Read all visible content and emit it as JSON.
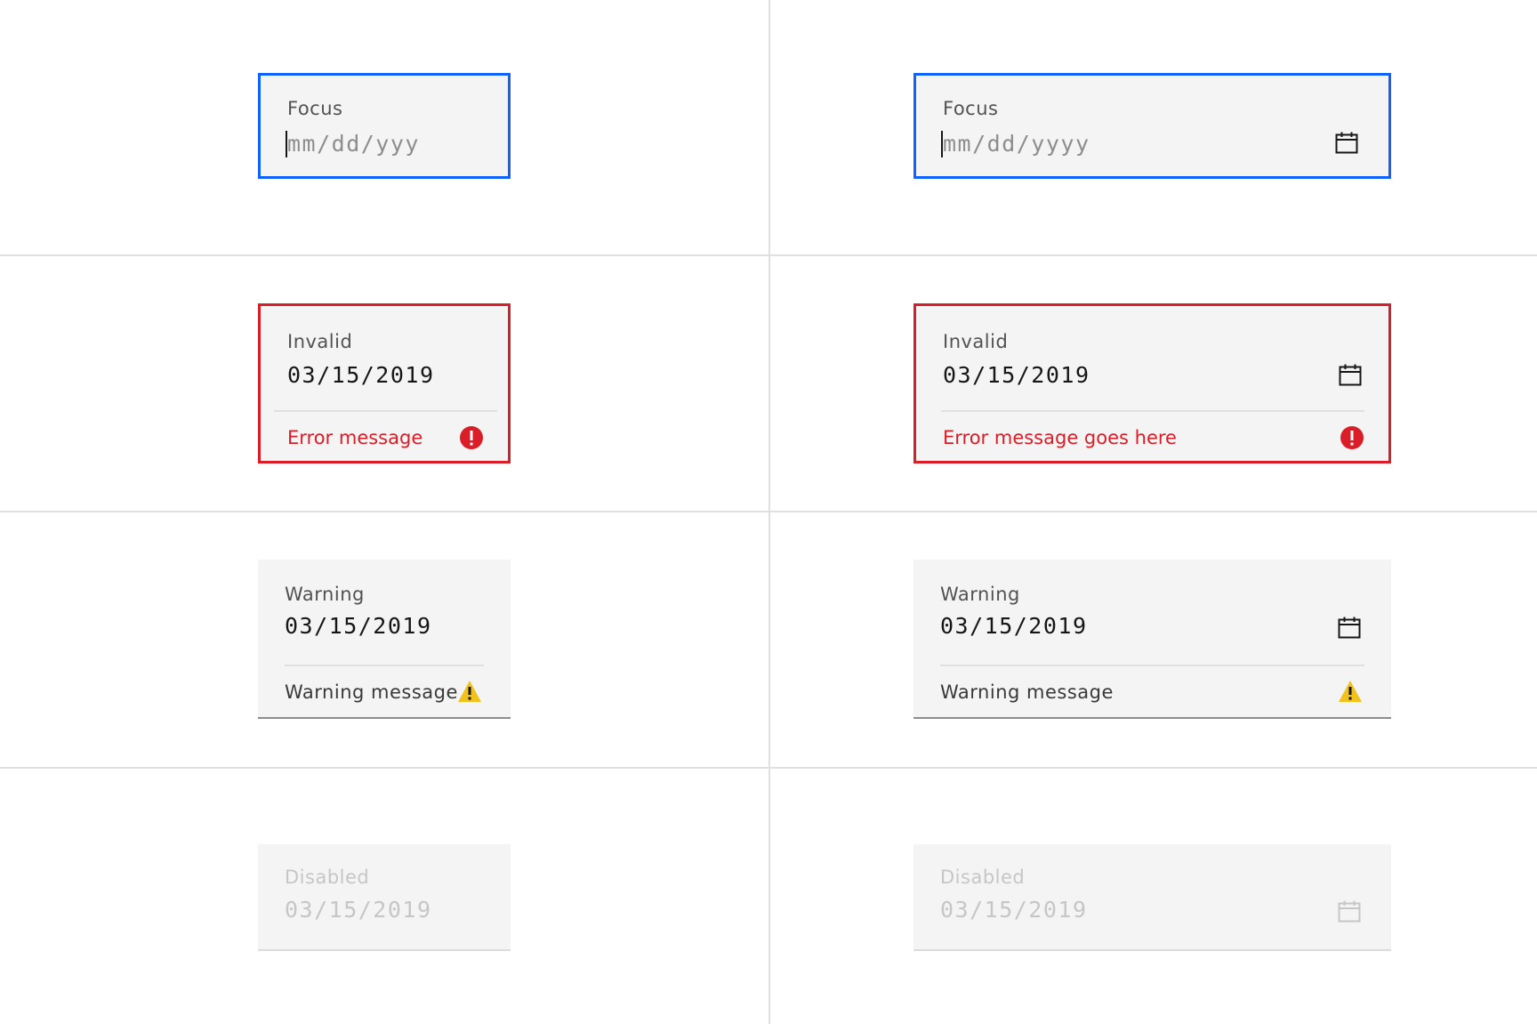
{
  "colors": {
    "focus": "#0f62fe",
    "error": "#da1e28",
    "warning": "#f1c21b",
    "field_background": "#f4f4f4",
    "disabled_text": "#c6c6c6"
  },
  "rows": {
    "focus": {
      "simple": {
        "label": "Focus",
        "placeholder": "mm/dd/yyy"
      },
      "with_calendar": {
        "label": "Focus",
        "placeholder": "mm/dd/yyyy",
        "icon": "calendar-icon"
      }
    },
    "invalid": {
      "simple": {
        "label": "Invalid",
        "value": "03/15/2019",
        "message": "Error message",
        "icon": "error-icon"
      },
      "with_calendar": {
        "label": "Invalid",
        "value": "03/15/2019",
        "message": "Error message goes here",
        "icon": "calendar-icon",
        "status_icon": "error-icon"
      }
    },
    "warning": {
      "simple": {
        "label": "Warning",
        "value": "03/15/2019",
        "message": "Warning message",
        "icon": "warning-icon"
      },
      "with_calendar": {
        "label": "Warning",
        "value": "03/15/2019",
        "message": "Warning message",
        "icon": "calendar-icon",
        "status_icon": "warning-icon"
      }
    },
    "disabled": {
      "simple": {
        "label": "Disabled",
        "value": "03/15/2019"
      },
      "with_calendar": {
        "label": "Disabled",
        "value": "03/15/2019",
        "icon": "calendar-icon"
      }
    }
  }
}
